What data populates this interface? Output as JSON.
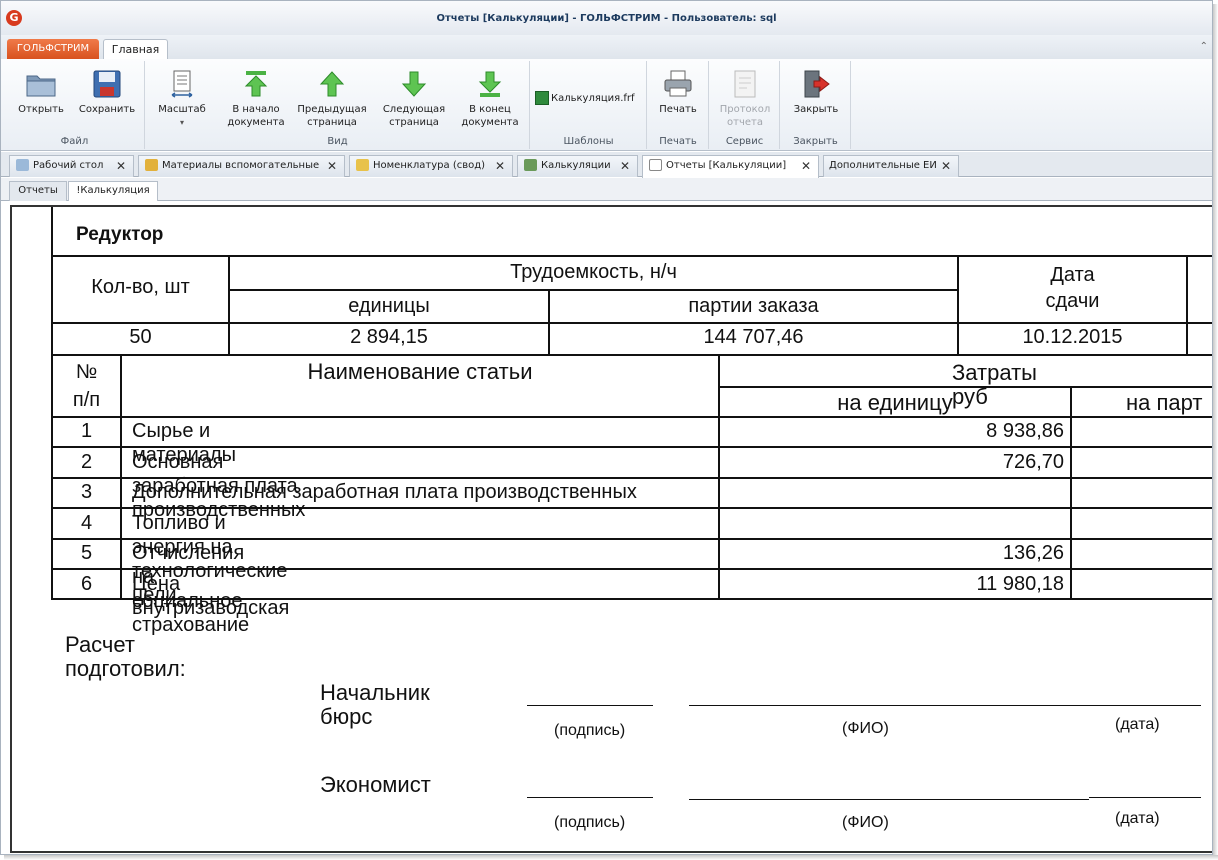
{
  "window": {
    "title": "Отчеты  [Калькуляции] - ГОЛЬФСТРИМ - Пользователь: sql",
    "logo": "G"
  },
  "ribbon": {
    "app_button": "ГОЛЬФСТРИМ",
    "tab_home": "Главная",
    "collapse": "⌃",
    "groups": {
      "file": "Файл",
      "view": "Вид",
      "templates": "Шаблоны",
      "print": "Печать",
      "service": "Сервис",
      "close": "Закрыть"
    },
    "buttons": {
      "open": "Открыть",
      "save": "Сохранить",
      "scale": "Масштаб",
      "first1": "В начало",
      "first2": "документа",
      "prev1": "Предыдущая",
      "prev2": "страница",
      "next1": "Следующая",
      "next2": "страница",
      "last1": "В конец",
      "last2": "документа",
      "template": "Калькуляция.frf",
      "print": "Печать",
      "protocol1": "Протокол",
      "protocol2": "отчета",
      "close": "Закрыть"
    }
  },
  "doc_tabs": [
    "Рабочий стол",
    "Материалы вспомогательные",
    "Номенклатура (свод)",
    "Калькуляции",
    "Отчеты [Калькуляции]",
    "Дополнительные ЕИ"
  ],
  "sub_tabs": [
    "Отчеты",
    "!Калькуляция"
  ],
  "report": {
    "title": "Редуктор",
    "qty_header": "Кол-во, шт",
    "labor_header": "Трудоемкость, н/ч",
    "unit_header": "единицы",
    "batch_header": "партии заказа",
    "date_header_1": "Дата",
    "date_header_2": "сдачи",
    "qty": "50",
    "labor_unit": "2 894,15",
    "labor_batch": "144 707,46",
    "date": "10.12.2015",
    "no_header_1": "№",
    "no_header_2": "п/п",
    "name_header": "Наименование статьи",
    "cost_header": "Затраты руб",
    "per_unit_header": "на единицу",
    "per_batch_header": "на парт",
    "rows": [
      {
        "n": "1",
        "name": "Сырье и материалы",
        "unit": "8 938,86"
      },
      {
        "n": "2",
        "name": "Основная заработная плата производственных",
        "unit": "726,70"
      },
      {
        "n": "3",
        "name": "Дополнительная заработная плата производственных",
        "unit": ""
      },
      {
        "n": "4",
        "name": "Топливо и энергия на технологические цели",
        "unit": ""
      },
      {
        "n": "5",
        "name": "Отчисления на социальное страхование",
        "unit": "136,26"
      },
      {
        "n": "6",
        "name": "Цена внутризаводская",
        "unit": "11 980,18"
      }
    ],
    "prepared": "Расчет подготовил:",
    "sign1_role": "Начальник бюрс",
    "sign2_role": "Экономист",
    "sig": "(подпись)",
    "fio": "(ФИО)",
    "date_lbl": "(дата)"
  }
}
